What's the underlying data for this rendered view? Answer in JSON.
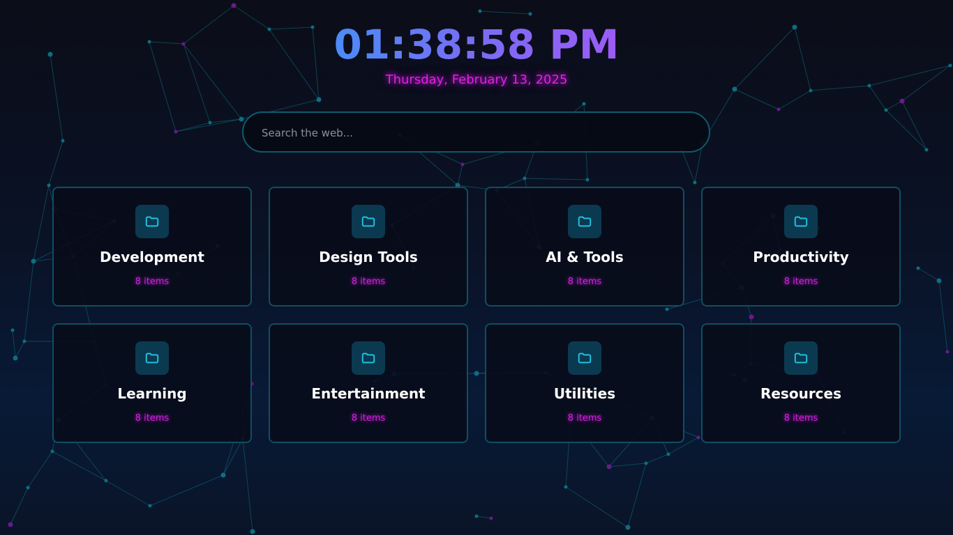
{
  "clock": {
    "time": "01:38:58 PM"
  },
  "date": {
    "text": "Thursday, February 13, 2025"
  },
  "search": {
    "placeholder": "Search the web..."
  },
  "categories": [
    {
      "title": "Development",
      "count": "8 items",
      "icon": "folder-icon"
    },
    {
      "title": "Design Tools",
      "count": "8 items",
      "icon": "folder-icon"
    },
    {
      "title": "AI & Tools",
      "count": "8 items",
      "icon": "folder-icon"
    },
    {
      "title": "Productivity",
      "count": "8 items",
      "icon": "folder-icon"
    },
    {
      "title": "Learning",
      "count": "8 items",
      "icon": "folder-icon"
    },
    {
      "title": "Entertainment",
      "count": "8 items",
      "icon": "folder-icon"
    },
    {
      "title": "Utilities",
      "count": "8 items",
      "icon": "folder-icon"
    },
    {
      "title": "Resources",
      "count": "8 items",
      "icon": "folder-icon"
    }
  ],
  "colors": {
    "clock_gradient_start": "#4a8cf7",
    "clock_gradient_end": "#9b5cf6",
    "accent_magenta": "#e020e8",
    "accent_cyan": "#22c8e8",
    "card_border": "#0f4f62",
    "network_line": "#0f6f80",
    "network_node_teal": "#0e6e80",
    "network_node_purple": "#6a1a8a"
  }
}
